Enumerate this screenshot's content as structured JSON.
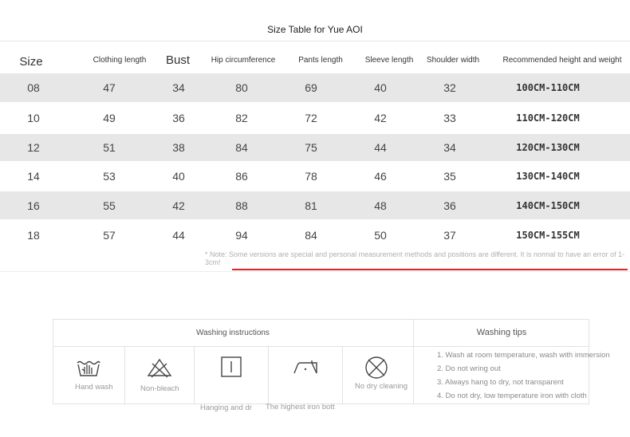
{
  "title": "Size Table for Yue AOI",
  "size_table": {
    "headers": [
      "Size",
      "Clothing length",
      "Bust",
      "Hip circumference",
      "Pants length",
      "Sleeve length",
      "Shoulder width",
      "Recommended height and weight"
    ],
    "rows": [
      [
        "08",
        "47",
        "34",
        "80",
        "69",
        "40",
        "32",
        "100CM-110CM"
      ],
      [
        "10",
        "49",
        "36",
        "82",
        "72",
        "42",
        "33",
        "110CM-120CM"
      ],
      [
        "12",
        "51",
        "38",
        "84",
        "75",
        "44",
        "34",
        "120CM-130CM"
      ],
      [
        "14",
        "53",
        "40",
        "86",
        "78",
        "46",
        "35",
        "130CM-140CM"
      ],
      [
        "16",
        "55",
        "42",
        "88",
        "81",
        "48",
        "36",
        "140CM-150CM"
      ],
      [
        "18",
        "57",
        "44",
        "94",
        "84",
        "50",
        "37",
        "150CM-155CM"
      ]
    ]
  },
  "note": "* Note: Some versions are special and personal measurement methods and positions are different. It is normal to have an error of 1-3cm!",
  "washing": {
    "instructions_title": "Washing instructions",
    "tips_title": "Washing tips",
    "icons": [
      {
        "icon": "hand-wash-icon",
        "label": "Hand wash"
      },
      {
        "icon": "non-bleach-icon",
        "label": "Non-bleach"
      },
      {
        "icon": "hang-dry-icon",
        "label": "Hanging and dr"
      },
      {
        "icon": "iron-icon",
        "label": "The highest iron bott"
      },
      {
        "icon": "no-dry-clean-icon",
        "label": "No dry cleaning"
      }
    ],
    "tips": [
      "1. Wash at room temperature, wash with immersion",
      "2. Do not wring out",
      "3. Always hang to dry, not transparent",
      "4. Do not dry, low temperature iron with cloth"
    ]
  },
  "colors": {
    "alt_row": "#e7e7e7",
    "accent_line": "#d9262c"
  }
}
